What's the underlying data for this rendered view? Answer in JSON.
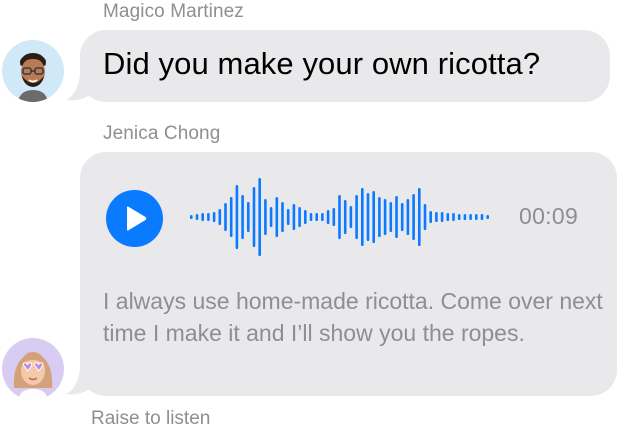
{
  "messages": [
    {
      "sender": "Magico Martinez",
      "avatar": "memoji-man-with-glasses-icon",
      "text": "Did you make your own ricotta?"
    },
    {
      "sender": "Jenica Chong",
      "avatar": "memoji-woman-with-heart-glasses-icon",
      "audio": {
        "duration": "00:09",
        "play_icon": "play-icon",
        "accent_color": "#0a7aff"
      },
      "transcript": "I always use home-made ricotta. Come over next time I make it and I’ll show you the ropes."
    }
  ],
  "footer": {
    "hint": "Raise to listen"
  },
  "colors": {
    "bubble": "#e9e9eb",
    "secondary_text": "#8e8e93",
    "accent": "#0a7aff"
  }
}
